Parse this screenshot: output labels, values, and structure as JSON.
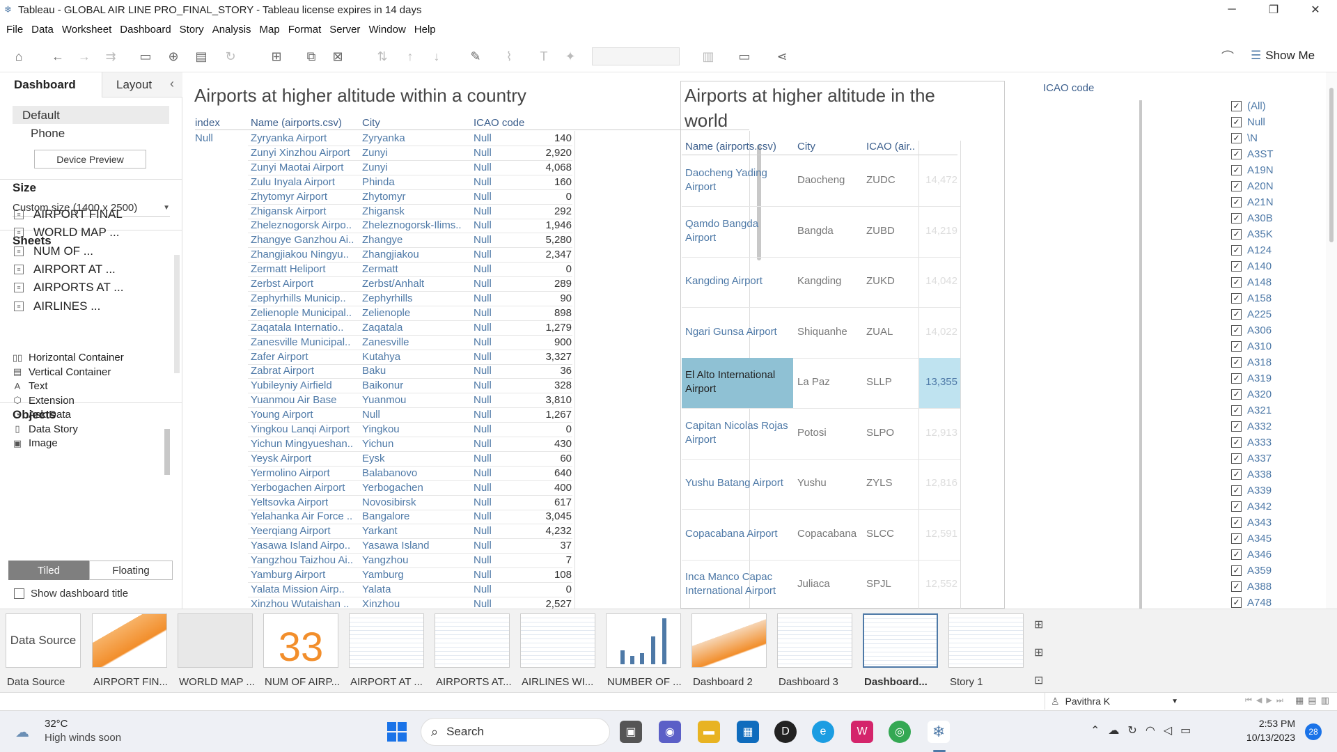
{
  "window": {
    "title": "Tableau - GLOBAL AIR LINE PRO_FINAL_STORY - Tableau license expires in 14 days",
    "minimize": "─",
    "restore": "❐",
    "close": "✕"
  },
  "menu": [
    "File",
    "Data",
    "Worksheet",
    "Dashboard",
    "Story",
    "Analysis",
    "Map",
    "Format",
    "Server",
    "Window",
    "Help"
  ],
  "toolbar": {
    "show_me": "Show Me"
  },
  "left_panel": {
    "tab_dashboard": "Dashboard",
    "tab_layout": "Layout",
    "collapse": "‹",
    "devices": [
      "Default",
      "Phone"
    ],
    "device_preview": "Device Preview",
    "size_heading": "Size",
    "size_value": "Custom size (1400 x 2500)",
    "sheets_heading": "Sheets",
    "sheets": [
      "AIRPORT FINAL",
      "WORLD MAP ...",
      "NUM OF ...",
      "AIRPORT AT ...",
      "AIRPORTS AT ...",
      "AIRLINES ..."
    ],
    "objects_heading": "Objects",
    "objects": [
      {
        "label": "Horizontal Container",
        "icon": "▯▯"
      },
      {
        "label": "Vertical Container",
        "icon": "▤"
      },
      {
        "label": "Text",
        "icon": "A"
      },
      {
        "label": "Extension",
        "icon": "⬡"
      },
      {
        "label": "Ask Data",
        "icon": "◔"
      },
      {
        "label": "Data Story",
        "icon": "▯"
      },
      {
        "label": "Image",
        "icon": "▣"
      }
    ],
    "tiled": "Tiled",
    "floating": "Floating",
    "show_title": "Show dashboard title"
  },
  "country_view": {
    "title": "Airports at higher altitude within a country",
    "headers": {
      "index": "index",
      "name": "Name (airports.csv)",
      "city": "City",
      "icao": "ICAO code"
    },
    "index_value": "Null",
    "rows": [
      [
        "Zyryanka Airport",
        "Zyryanka",
        "Null",
        "140"
      ],
      [
        "Zunyi Xinzhou Airport",
        "Zunyi",
        "Null",
        "2,920"
      ],
      [
        "Zunyi Maotai Airport",
        "Zunyi",
        "Null",
        "4,068"
      ],
      [
        "Zulu Inyala Airport",
        "Phinda",
        "Null",
        "160"
      ],
      [
        "Zhytomyr Airport",
        "Zhytomyr",
        "Null",
        "0"
      ],
      [
        "Zhigansk Airport",
        "Zhigansk",
        "Null",
        "292"
      ],
      [
        "Zheleznogorsk Airpo..",
        "Zheleznogorsk-Ilims..",
        "Null",
        "1,946"
      ],
      [
        "Zhangye Ganzhou Ai..",
        "Zhangye",
        "Null",
        "5,280"
      ],
      [
        "Zhangjiakou Ningyu..",
        "Zhangjiakou",
        "Null",
        "2,347"
      ],
      [
        "Zermatt  Heliport",
        "Zermatt",
        "Null",
        "0"
      ],
      [
        "Zerbst Airport",
        "Zerbst/Anhalt",
        "Null",
        "289"
      ],
      [
        "Zephyrhills Municip..",
        "Zephyrhills",
        "Null",
        "90"
      ],
      [
        "Zelienople Municipal..",
        "Zelienople",
        "Null",
        "898"
      ],
      [
        "Zaqatala Internatio..",
        "Zaqatala",
        "Null",
        "1,279"
      ],
      [
        "Zanesville Municipal..",
        "Zanesville",
        "Null",
        "900"
      ],
      [
        "Zafer Airport",
        "Kutahya",
        "Null",
        "3,327"
      ],
      [
        "Zabrat Airport",
        "Baku",
        "Null",
        "36"
      ],
      [
        "Yubileyniy Airfield",
        "Baikonur",
        "Null",
        "328"
      ],
      [
        "Yuanmou Air Base",
        "Yuanmou",
        "Null",
        "3,810"
      ],
      [
        "Young Airport",
        "Null",
        "Null",
        "1,267"
      ],
      [
        "Yingkou Lanqi Airport",
        "Yingkou",
        "Null",
        "0"
      ],
      [
        "Yichun Mingyueshan..",
        "Yichun",
        "Null",
        "430"
      ],
      [
        "Yeysk Airport",
        "Eysk",
        "Null",
        "60"
      ],
      [
        "Yermolino Airport",
        "Balabanovo",
        "Null",
        "640"
      ],
      [
        "Yerbogachen Airport",
        "Yerbogachen",
        "Null",
        "400"
      ],
      [
        "Yeltsovka Airport",
        "Novosibirsk",
        "Null",
        "617"
      ],
      [
        "Yelahanka Air Force ..",
        "Bangalore",
        "Null",
        "3,045"
      ],
      [
        "Yeerqiang Airport",
        "Yarkant",
        "Null",
        "4,232"
      ],
      [
        "Yasawa Island Airpo..",
        "Yasawa Island",
        "Null",
        "37"
      ],
      [
        "Yangzhou Taizhou Ai..",
        "Yangzhou",
        "Null",
        "7"
      ],
      [
        "Yamburg Airport",
        "Yamburg",
        "Null",
        "108"
      ],
      [
        "Yalata Mission Airp..",
        "Yalata",
        "Null",
        "0"
      ],
      [
        "Xinzhou Wutaishan ..",
        "Xinzhou",
        "Null",
        "2,527"
      ]
    ]
  },
  "world_view": {
    "title_line1": "Airports at higher altitude in the",
    "title_line2": "world",
    "headers": {
      "name": "Name (airports.csv)",
      "city": "City",
      "icao": "ICAO (air.."
    },
    "rows": [
      {
        "name1": "Daocheng Yading",
        "name2": "Airport",
        "city": "Daocheng",
        "icao": "ZUDC",
        "alt": "14,472"
      },
      {
        "name1": "Qamdo Bangda",
        "name2": "Airport",
        "city": "Bangda",
        "icao": "ZUBD",
        "alt": "14,219"
      },
      {
        "name1": "Kangding Airport",
        "name2": "",
        "city": "Kangding",
        "icao": "ZUKD",
        "alt": "14,042"
      },
      {
        "name1": "Ngari Gunsa Airport",
        "name2": "",
        "city": "Shiquanhe",
        "icao": "ZUAL",
        "alt": "14,022"
      },
      {
        "name1": "El Alto International",
        "name2": "Airport",
        "city": "La Paz",
        "icao": "SLLP",
        "alt": "13,355"
      },
      {
        "name1": "Capitan Nicolas Rojas",
        "name2": "Airport",
        "city": "Potosi",
        "icao": "SLPO",
        "alt": "12,913"
      },
      {
        "name1": "Yushu Batang Airport",
        "name2": "",
        "city": "Yushu",
        "icao": "ZYLS",
        "alt": "12,816"
      },
      {
        "name1": "Copacabana Airport",
        "name2": "",
        "city": "Copacabana",
        "icao": "SLCC",
        "alt": "12,591"
      },
      {
        "name1": "Inca Manco Capac",
        "name2": "International Airport",
        "city": "Juliaca",
        "icao": "SPJL",
        "alt": "12,552"
      }
    ],
    "selected_row": 4
  },
  "filter": {
    "title": "ICAO code",
    "items": [
      "(All)",
      "Null",
      "\\N",
      "A3ST",
      "A19N",
      "A20N",
      "A21N",
      "A30B",
      "A35K",
      "A124",
      "A140",
      "A148",
      "A158",
      "A225",
      "A306",
      "A310",
      "A318",
      "A319",
      "A320",
      "A321",
      "A332",
      "A333",
      "A337",
      "A338",
      "A339",
      "A342",
      "A343",
      "A345",
      "A346",
      "A359",
      "A388",
      "A748"
    ]
  },
  "sheet_tabs": [
    {
      "label": "Data Source",
      "thumb": "Data Source"
    },
    {
      "label": "AIRPORT FIN..."
    },
    {
      "label": "WORLD MAP ..."
    },
    {
      "label": "NUM OF AIRP...",
      "thumb": "33"
    },
    {
      "label": "AIRPORT AT ..."
    },
    {
      "label": "AIRPORTS AT..."
    },
    {
      "label": "AIRLINES WI..."
    },
    {
      "label": "NUMBER OF ..."
    },
    {
      "label": "Dashboard 2"
    },
    {
      "label": "Dashboard 3"
    },
    {
      "label": "Dashboard..."
    },
    {
      "label": "Story 1"
    }
  ],
  "status": {
    "user": "Pavithra  K"
  },
  "taskbar": {
    "temp": "32°C",
    "weather": "High winds soon",
    "search": "Search",
    "time": "2:53 PM",
    "date": "10/13/2023",
    "badge": "28"
  },
  "colors": {
    "accent": "#4e79a7",
    "selected_row": "#8fc1d4",
    "selected_value": "#bfe3f0"
  }
}
